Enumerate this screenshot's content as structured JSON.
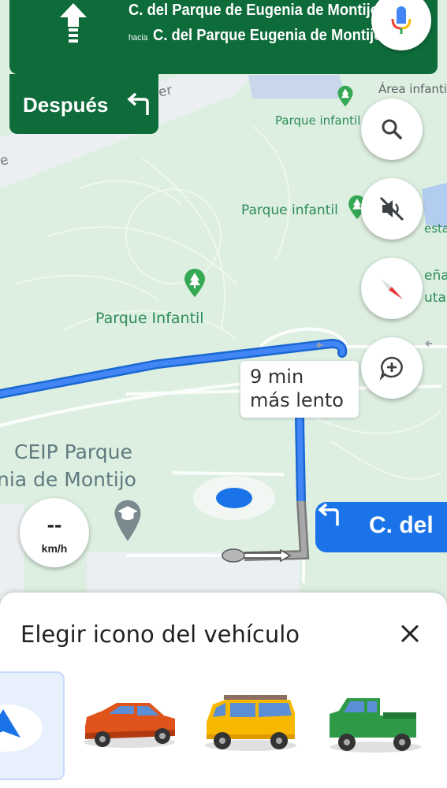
{
  "navigation": {
    "street": "C. del Parque de Eugenia de Montijo",
    "toward_word": "hacia",
    "toward_street": "C. del Parque Eugenia de Montijo",
    "then_label": "Después",
    "mic_icon": "mic-icon",
    "direction_icon": "arrow-up-icon",
    "then_icon": "turn-left-icon"
  },
  "map": {
    "labels": {
      "parque_infantil_1": "Parque infantil",
      "parque_infantil_2": "Parque infantil",
      "parque_infantil_3": "Parque Infantil",
      "area_infantil": "Área infantil",
      "ceip_line1": "CEIP Parque",
      "ceip_line2": "nia de Montijo",
      "partial_er": "er",
      "partial_e": "e",
      "partial_esta": "esta",
      "partial_ena": "eña",
      "partial_utas": "utas"
    },
    "eta": {
      "line1": "9 min",
      "line2": "más lento"
    },
    "speed": {
      "value": "--",
      "unit": "km/h"
    },
    "next_turn": {
      "label": "C. del",
      "icon": "turn-left-icon"
    }
  },
  "controls": [
    {
      "name": "search-button",
      "icon": "search-icon"
    },
    {
      "name": "mute-button",
      "icon": "volume-off-icon"
    },
    {
      "name": "compass-button",
      "icon": "compass-icon"
    },
    {
      "name": "report-button",
      "icon": "add-comment-icon"
    }
  ],
  "colors": {
    "nav_green": "#0e6b3a",
    "route_blue": "#4285f4",
    "accent_blue": "#1a73e8",
    "park_green": "#dcefe0"
  },
  "sheet": {
    "title": "Elegir icono del vehículo",
    "close_icon": "close-icon",
    "vehicles": [
      {
        "name": "navigation-arrow",
        "selected": true
      },
      {
        "name": "red-sedan",
        "selected": false
      },
      {
        "name": "yellow-suv",
        "selected": false
      },
      {
        "name": "green-pickup",
        "selected": false
      }
    ]
  }
}
